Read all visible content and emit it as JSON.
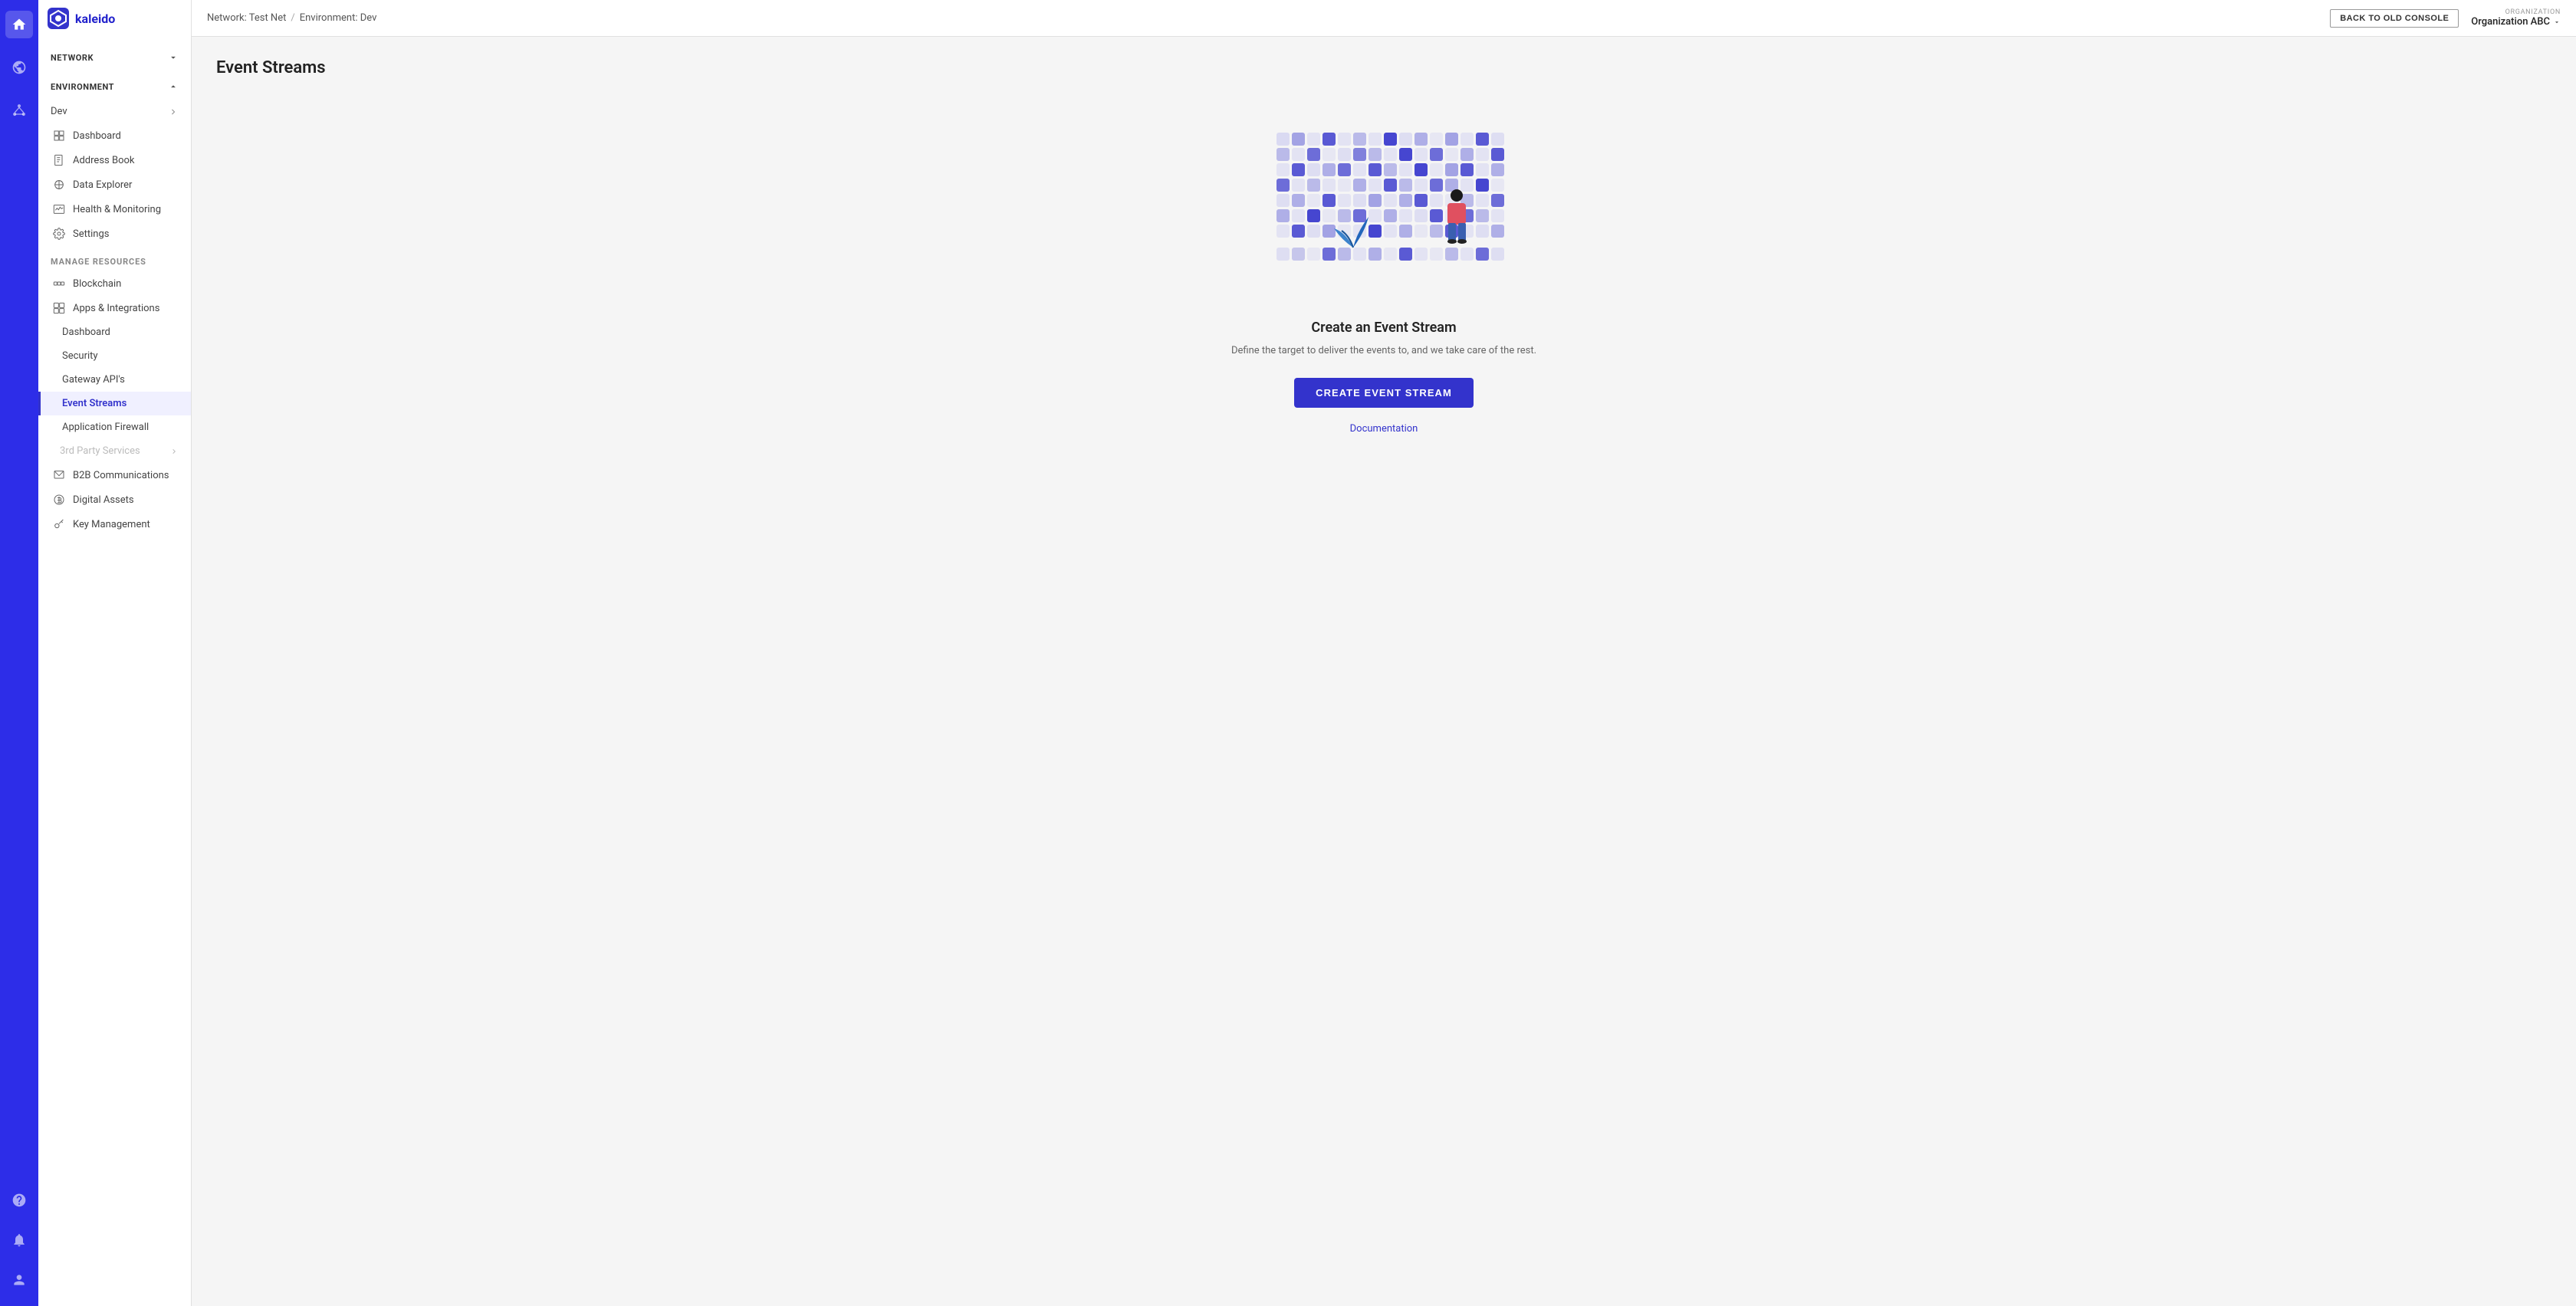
{
  "iconbar": {
    "icons": [
      {
        "name": "home-icon",
        "symbol": "🏠",
        "active": true
      },
      {
        "name": "globe-icon",
        "symbol": "🌐",
        "active": false
      },
      {
        "name": "network-icon",
        "symbol": "⬡",
        "active": false
      }
    ],
    "bottom_icons": [
      {
        "name": "help-icon",
        "symbol": "?"
      },
      {
        "name": "bell-icon",
        "symbol": "🔔"
      },
      {
        "name": "user-icon",
        "symbol": "👤"
      }
    ]
  },
  "sidebar": {
    "network_label": "NETWORK",
    "environment_label": "ENVIRONMENT",
    "dev_label": "Dev",
    "items": [
      {
        "label": "Dashboard",
        "name": "sidebar-item-dashboard",
        "active": false
      },
      {
        "label": "Address Book",
        "name": "sidebar-item-address-book",
        "active": false
      },
      {
        "label": "Data Explorer",
        "name": "sidebar-item-data-explorer",
        "active": false
      },
      {
        "label": "Health & Monitoring",
        "name": "sidebar-item-health",
        "active": false
      },
      {
        "label": "Settings",
        "name": "sidebar-item-settings",
        "active": false
      }
    ],
    "manage_label": "MANAGE RESOURCES",
    "manage_items": [
      {
        "label": "Blockchain",
        "name": "sidebar-item-blockchain",
        "active": false
      },
      {
        "label": "Apps & Integrations",
        "name": "sidebar-item-apps",
        "active": false
      }
    ],
    "sub_items": [
      {
        "label": "Dashboard",
        "name": "sidebar-sub-dashboard",
        "active": false
      },
      {
        "label": "Security",
        "name": "sidebar-sub-security",
        "active": false
      },
      {
        "label": "Gateway API's",
        "name": "sidebar-sub-gateway",
        "active": false
      },
      {
        "label": "Event Streams",
        "name": "sidebar-sub-event-streams",
        "active": true
      },
      {
        "label": "Application Firewall",
        "name": "sidebar-sub-firewall",
        "active": false
      }
    ],
    "third_party_label": "3rd Party Services",
    "more_items": [
      {
        "label": "B2B Communications",
        "name": "sidebar-item-b2b",
        "active": false
      },
      {
        "label": "Digital Assets",
        "name": "sidebar-item-digital",
        "active": false
      },
      {
        "label": "Key Management",
        "name": "sidebar-item-key",
        "active": false
      }
    ]
  },
  "topbar": {
    "breadcrumb_network": "Network: Test Net",
    "breadcrumb_sep": "/",
    "breadcrumb_env": "Environment: Dev",
    "back_button_label": "BACK TO OLD CONSOLE",
    "org_label": "ORGANIZATION",
    "org_name": "Organization ABC"
  },
  "main": {
    "page_title": "Event Streams",
    "empty_title": "Create an Event Stream",
    "empty_desc": "Define the target to deliver the events to, and we take care of the rest.",
    "create_button": "CREATE EVENT STREAM",
    "doc_link": "Documentation"
  }
}
